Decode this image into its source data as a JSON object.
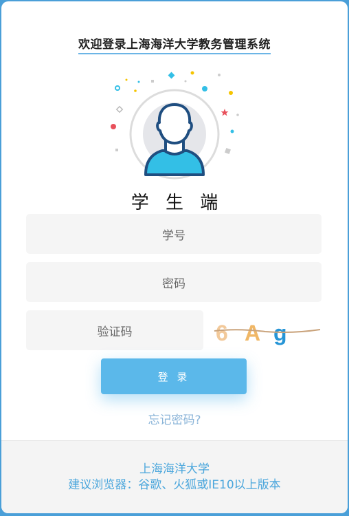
{
  "header": {
    "title": "欢迎登录上海海洋大学教务管理系统"
  },
  "role": {
    "label": "学 生 端"
  },
  "form": {
    "student_id_placeholder": "学号",
    "password_placeholder": "密码",
    "captcha_placeholder": "验证码",
    "captcha_text": "6Ag",
    "login_label": "登 录",
    "forgot_label": "忘记密码?"
  },
  "footer": {
    "school": "上海海洋大学",
    "browser_tip": "建议浏览器：谷歌、火狐或IE10以上版本"
  },
  "colors": {
    "accent": "#5bb8ea",
    "avatar_shirt": "#33bfe6",
    "avatar_outline": "#1f4e80",
    "footer_text": "#4aa6dc"
  },
  "icons": {
    "avatar": "user-avatar-icon"
  }
}
